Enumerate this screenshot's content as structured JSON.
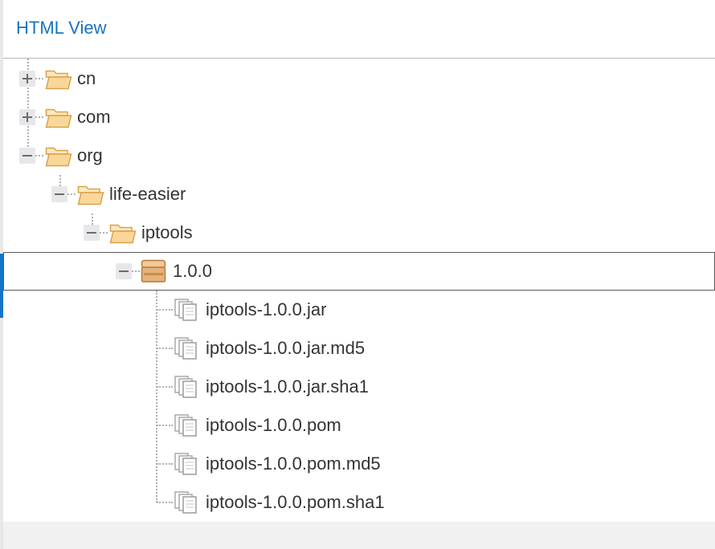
{
  "header": {
    "title": "HTML View"
  },
  "tree": {
    "nodes": [
      {
        "label": "cn",
        "type": "folder",
        "state": "collapsed",
        "depth": 0
      },
      {
        "label": "com",
        "type": "folder",
        "state": "collapsed",
        "depth": 0
      },
      {
        "label": "org",
        "type": "folder",
        "state": "expanded",
        "depth": 0
      },
      {
        "label": "life-easier",
        "type": "folder",
        "state": "expanded",
        "depth": 1
      },
      {
        "label": "iptools",
        "type": "folder",
        "state": "expanded",
        "depth": 2
      },
      {
        "label": "1.0.0",
        "type": "package",
        "state": "expanded",
        "depth": 3,
        "selected": true
      },
      {
        "label": "iptools-1.0.0.jar",
        "type": "file",
        "depth": 4
      },
      {
        "label": "iptools-1.0.0.jar.md5",
        "type": "file",
        "depth": 4
      },
      {
        "label": "iptools-1.0.0.jar.sha1",
        "type": "file",
        "depth": 4
      },
      {
        "label": "iptools-1.0.0.pom",
        "type": "file",
        "depth": 4
      },
      {
        "label": "iptools-1.0.0.pom.md5",
        "type": "file",
        "depth": 4
      },
      {
        "label": "iptools-1.0.0.pom.sha1",
        "type": "file",
        "depth": 4
      }
    ]
  },
  "icons": {
    "folder": "folder-open-icon",
    "package": "package-box-icon",
    "file": "file-documents-icon",
    "collapsed": "expand-plus-icon",
    "expanded": "collapse-minus-icon"
  },
  "colors": {
    "accent": "#1474c8",
    "folder_fill": "#f9d79a",
    "folder_stroke": "#d9a24a",
    "package_fill": "#e4b27a",
    "selected_border": "#595959"
  }
}
